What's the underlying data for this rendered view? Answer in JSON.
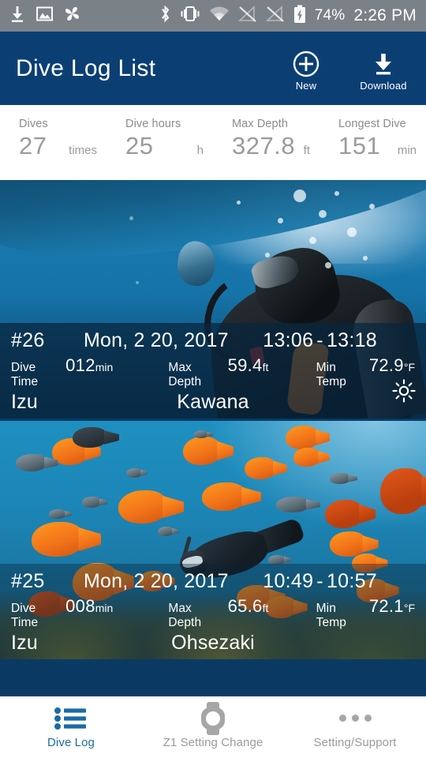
{
  "status_bar": {
    "left_icons": [
      "download-icon",
      "image-icon",
      "pinwheel-icon"
    ],
    "right_icons": [
      "bluetooth-icon",
      "vibrate-icon",
      "wifi-icon",
      "sim1-no-signal-icon",
      "sim2-no-signal-icon",
      "battery-charging-icon"
    ],
    "battery_percent": "74%",
    "time": "2:26 PM",
    "background_color": "#7b8287"
  },
  "header": {
    "title": "Dive Log List",
    "background_color": "#0b3f74",
    "actions": [
      {
        "label": "New",
        "icon": "plus-circle-icon"
      },
      {
        "label": "Download",
        "icon": "download-arrow-icon"
      }
    ]
  },
  "stats": [
    {
      "label": "Dives",
      "value": "27",
      "unit": "times"
    },
    {
      "label": "Dive hours",
      "value": "25",
      "unit": "h"
    },
    {
      "label": "Max Depth",
      "value": "327.8",
      "unit": "ft"
    },
    {
      "label": "Longest Dive",
      "value": "151",
      "unit": "min"
    }
  ],
  "dive_logs": [
    {
      "number": "#26",
      "date": "Mon, 2 20, 2017",
      "time_start": "13:06",
      "time_dash": "-",
      "time_end": "13:18",
      "dive_time_label": "Dive Time",
      "dive_time_value": "012",
      "dive_time_unit": "min",
      "max_depth_label": "Max Depth",
      "max_depth_value": "59.4",
      "max_depth_unit": "ft",
      "min_temp_label": "Min Temp",
      "min_temp_value": "72.9",
      "min_temp_unit": "°F",
      "area": "Izu",
      "point": "Kawana",
      "weather_icon": "sun-icon",
      "photo": "scuba-diver-under-boat-photo"
    },
    {
      "number": "#25",
      "date": "Mon, 2 20, 2017",
      "time_start": "10:49",
      "time_dash": "-",
      "time_end": "10:57",
      "dive_time_label": "Dive Time",
      "dive_time_value": "008",
      "dive_time_unit": "min",
      "max_depth_label": "Max Depth",
      "max_depth_value": "65.6",
      "max_depth_unit": "ft",
      "min_temp_label": "Min Temp",
      "min_temp_value": "72.1",
      "min_temp_unit": "°F",
      "area": "Izu",
      "point": "Ohsezaki",
      "weather_icon": "",
      "photo": "freediver-with-garibaldi-fish-photo"
    }
  ],
  "bottom_nav": {
    "active_color": "#1a6aa8",
    "inactive_color": "#9a9a9a",
    "items": [
      {
        "label": "Dive Log",
        "icon": "list-icon",
        "active": true
      },
      {
        "label": "Z1 Setting Change",
        "icon": "watch-icon",
        "active": false
      },
      {
        "label": "Setting/Support",
        "icon": "ellipsis-icon",
        "active": false
      }
    ]
  }
}
